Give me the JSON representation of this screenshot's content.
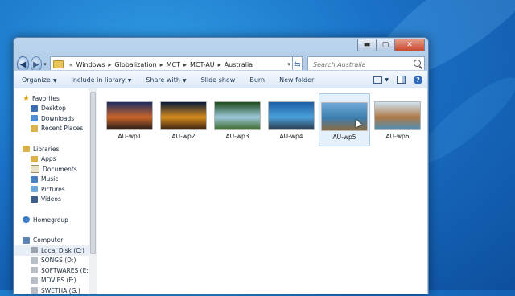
{
  "window": {
    "caption_buttons": {
      "minimize": "▬",
      "maximize": "▢",
      "close": "✕"
    },
    "nav": {
      "back_icon": "back-arrow-icon",
      "forward_icon": "forward-arrow-icon",
      "back_glyph": "◀",
      "forward_glyph": "▶",
      "recent_glyph": "▾"
    },
    "address": {
      "prefix": "«",
      "crumbs": [
        "Windows",
        "Globalization",
        "MCT",
        "MCT-AU",
        "Australia"
      ],
      "separator": "▸",
      "dropdown": "▾",
      "refresh_glyph": "⇆"
    },
    "search": {
      "placeholder": "Search Australia"
    }
  },
  "toolbar": {
    "items": [
      {
        "label": "Organize",
        "dropdown": true
      },
      {
        "label": "Include in library",
        "dropdown": true
      },
      {
        "label": "Share with",
        "dropdown": true
      },
      {
        "label": "Slide show",
        "dropdown": false
      },
      {
        "label": "Burn",
        "dropdown": false
      },
      {
        "label": "New folder",
        "dropdown": false
      }
    ],
    "arrow": "▼",
    "help": "?"
  },
  "sidebar": {
    "favorites": {
      "label": "Favorites",
      "items": [
        "Desktop",
        "Downloads",
        "Recent Places"
      ]
    },
    "libraries": {
      "label": "Libraries",
      "items": [
        "Apps",
        "Documents",
        "Music",
        "Pictures",
        "Videos"
      ]
    },
    "homegroup": {
      "label": "Homegroup"
    },
    "computer": {
      "label": "Computer",
      "items": [
        "Local Disk (C:)",
        "SONGS (D:)",
        "SOFTWARES (E:)",
        "MOVIES (F:)",
        "SWETHA (G:)"
      ]
    }
  },
  "files": [
    {
      "name": "AU-wp1",
      "colors": [
        "#1b2d63",
        "#c9652a",
        "#2a1d18"
      ]
    },
    {
      "name": "AU-wp2",
      "colors": [
        "#071a3a",
        "#d58a1e",
        "#3a2210"
      ]
    },
    {
      "name": "AU-wp3",
      "colors": [
        "#1d4a1a",
        "#9cc7d8",
        "#3e6b2d"
      ]
    },
    {
      "name": "AU-wp4",
      "colors": [
        "#1d5ea6",
        "#4aa0da",
        "#2c3b4d"
      ]
    },
    {
      "name": "AU-wp5",
      "colors": [
        "#6fa9d9",
        "#3c7fb0",
        "#8a6a3e"
      ],
      "selected": true
    },
    {
      "name": "AU-wp6",
      "colors": [
        "#cfe3f0",
        "#b07a48",
        "#4c8fb2"
      ]
    }
  ]
}
